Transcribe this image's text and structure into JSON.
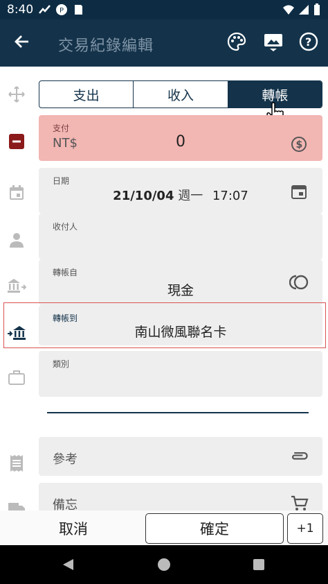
{
  "status": {
    "time": "8:40"
  },
  "appbar": {
    "title": "交易紀錄編輯",
    "back_icon": "arrow-left-icon",
    "palette_icon": "palette-icon",
    "image_icon": "image-icon",
    "help_icon": "help-icon"
  },
  "tabs": [
    {
      "label": "支出",
      "active": false
    },
    {
      "label": "收入",
      "active": false
    },
    {
      "label": "轉帳",
      "active": true
    }
  ],
  "payment": {
    "label": "支付",
    "currency": "NT$",
    "amount": "0"
  },
  "date": {
    "label": "日期",
    "date": "21/10/04",
    "weekday": "週一",
    "time": "17:07"
  },
  "payee": {
    "label": "收付人",
    "value": ""
  },
  "transfer_from": {
    "label": "轉帳自",
    "value": "現金"
  },
  "transfer_to": {
    "label": "轉帳到",
    "value": "南山微風聯名卡"
  },
  "category": {
    "label": "類別",
    "value": ""
  },
  "reference": {
    "placeholder": "參考"
  },
  "memo": {
    "placeholder": "備忘"
  },
  "actions": {
    "cancel": "取消",
    "confirm": "確定",
    "plus_one": "+1"
  },
  "colors": {
    "primary": "#14334b",
    "payment_bg": "#f2b6b3",
    "minus_red": "#8b1a1a",
    "highlight_border": "#d9534f"
  }
}
